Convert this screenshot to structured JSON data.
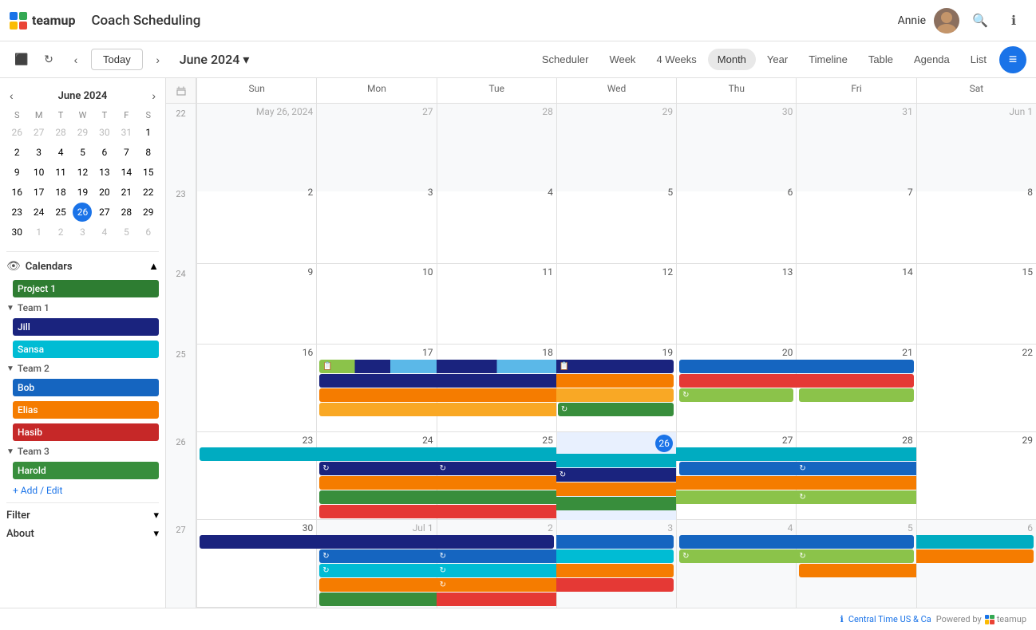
{
  "app": {
    "logo_text": "teamup",
    "title": "Coach Scheduling",
    "user_name": "Annie"
  },
  "nav": {
    "prev_label": "‹",
    "next_label": "›",
    "today_label": "Today",
    "month_title": "June 2024",
    "chevron": "▾",
    "views": [
      "Scheduler",
      "Week",
      "4 Weeks",
      "Month",
      "Year",
      "Timeline",
      "Table",
      "Agenda",
      "List"
    ],
    "active_view": "Month"
  },
  "mini_cal": {
    "title": "June 2024",
    "dow": [
      "S",
      "M",
      "T",
      "W",
      "T",
      "F",
      "S"
    ],
    "weeks": [
      [
        26,
        27,
        28,
        29,
        30,
        31,
        1
      ],
      [
        2,
        3,
        4,
        5,
        6,
        7,
        8
      ],
      [
        9,
        10,
        11,
        12,
        13,
        14,
        15
      ],
      [
        16,
        17,
        18,
        19,
        20,
        21,
        22
      ],
      [
        23,
        24,
        25,
        26,
        27,
        28,
        29
      ],
      [
        30,
        1,
        2,
        3,
        4,
        5,
        6
      ]
    ],
    "other_month_days": [
      26,
      27,
      28,
      29,
      30,
      31,
      1,
      30,
      1,
      2,
      3,
      4,
      5,
      6
    ],
    "today_day": 26
  },
  "calendars": {
    "section_label": "Calendars",
    "project1": {
      "label": "Project 1",
      "color": "#2e7d32"
    },
    "team1": {
      "label": "Team 1",
      "members": [
        {
          "label": "Jill",
          "color": "#1a237e"
        },
        {
          "label": "Sansa",
          "color": "#00bcd4"
        }
      ]
    },
    "team2": {
      "label": "Team 2",
      "members": [
        {
          "label": "Bob",
          "color": "#1565c0"
        },
        {
          "label": "Elias",
          "color": "#f57c00"
        },
        {
          "label": "Hasib",
          "color": "#c62828"
        }
      ]
    },
    "team3": {
      "label": "Team 3",
      "members": [
        {
          "label": "Harold",
          "color": "#388e3c"
        }
      ]
    },
    "add_edit_label": "+ Add / Edit"
  },
  "filter": {
    "label": "Filter"
  },
  "about": {
    "label": "About"
  },
  "calendar": {
    "dow_headers": [
      "Sun",
      "Mon",
      "Tue",
      "Wed",
      "Thu",
      "Fri",
      "Sat"
    ],
    "weeks": [
      {
        "num": 22,
        "days": [
          {
            "date": "May 26, 2024",
            "num": "26",
            "other": true
          },
          {
            "date": "27",
            "num": "27",
            "other": true
          },
          {
            "date": "28",
            "num": "28",
            "other": true
          },
          {
            "date": "29",
            "num": "29",
            "other": true
          },
          {
            "date": "30",
            "num": "30",
            "other": true
          },
          {
            "date": "31",
            "num": "31",
            "other": true
          },
          {
            "date": "Jun 1",
            "num": "Jun 1",
            "other": true
          }
        ]
      },
      {
        "num": 23,
        "days": [
          {
            "date": "2",
            "num": "2"
          },
          {
            "date": "3",
            "num": "3"
          },
          {
            "date": "4",
            "num": "4"
          },
          {
            "date": "5",
            "num": "5"
          },
          {
            "date": "6",
            "num": "6"
          },
          {
            "date": "7",
            "num": "7"
          },
          {
            "date": "8",
            "num": "8"
          }
        ]
      },
      {
        "num": 24,
        "days": [
          {
            "date": "9",
            "num": "9"
          },
          {
            "date": "10",
            "num": "10"
          },
          {
            "date": "11",
            "num": "11"
          },
          {
            "date": "12",
            "num": "12"
          },
          {
            "date": "13",
            "num": "13"
          },
          {
            "date": "14",
            "num": "14"
          },
          {
            "date": "15",
            "num": "15"
          }
        ]
      },
      {
        "num": 25,
        "days": [
          {
            "date": "16",
            "num": "16"
          },
          {
            "date": "17",
            "num": "17"
          },
          {
            "date": "18",
            "num": "18"
          },
          {
            "date": "19",
            "num": "19"
          },
          {
            "date": "20",
            "num": "20"
          },
          {
            "date": "21",
            "num": "21"
          },
          {
            "date": "22",
            "num": "22"
          }
        ]
      },
      {
        "num": 26,
        "days": [
          {
            "date": "23",
            "num": "23"
          },
          {
            "date": "24",
            "num": "24"
          },
          {
            "date": "25",
            "num": "25"
          },
          {
            "date": "26",
            "num": "26",
            "today": true
          },
          {
            "date": "27",
            "num": "27"
          },
          {
            "date": "28",
            "num": "28"
          },
          {
            "date": "29",
            "num": "29"
          }
        ]
      },
      {
        "num": 27,
        "days": [
          {
            "date": "30",
            "num": "30"
          },
          {
            "date": "Jul 1",
            "num": "Jul 1",
            "other": true
          },
          {
            "date": "2",
            "num": "2",
            "other": true
          },
          {
            "date": "3",
            "num": "3",
            "other": true
          },
          {
            "date": "4",
            "num": "4",
            "other": true
          },
          {
            "date": "5",
            "num": "5",
            "other": true
          },
          {
            "date": "6",
            "num": "6",
            "other": true
          }
        ]
      }
    ]
  },
  "footer": {
    "timezone": "Central Time US & Ca",
    "powered_by": "Powered by",
    "brand": "teamup"
  }
}
